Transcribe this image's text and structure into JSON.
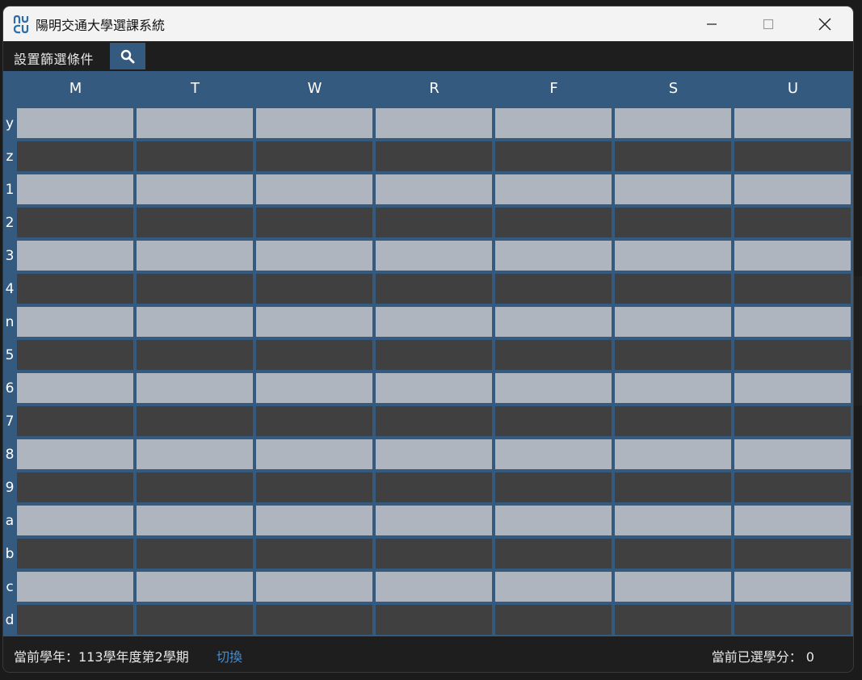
{
  "window": {
    "title": "陽明交通大學選課系統"
  },
  "toolbar": {
    "filter_label": "設置篩選條件",
    "search_icon": "search-icon"
  },
  "schedule": {
    "days": [
      "M",
      "T",
      "W",
      "R",
      "F",
      "S",
      "U"
    ],
    "periods": [
      "y",
      "z",
      "1",
      "2",
      "3",
      "4",
      "n",
      "5",
      "6",
      "7",
      "8",
      "9",
      "a",
      "b",
      "c",
      "d"
    ]
  },
  "status": {
    "semester_text": "當前學年：113學年度第2學期",
    "switch_label": "切換",
    "credits_text": "當前已選學分： 0"
  },
  "colors": {
    "accent": "#355a80",
    "cell_light": "#aeb5be",
    "cell_dark": "#404040",
    "link": "#3f8fd6"
  }
}
